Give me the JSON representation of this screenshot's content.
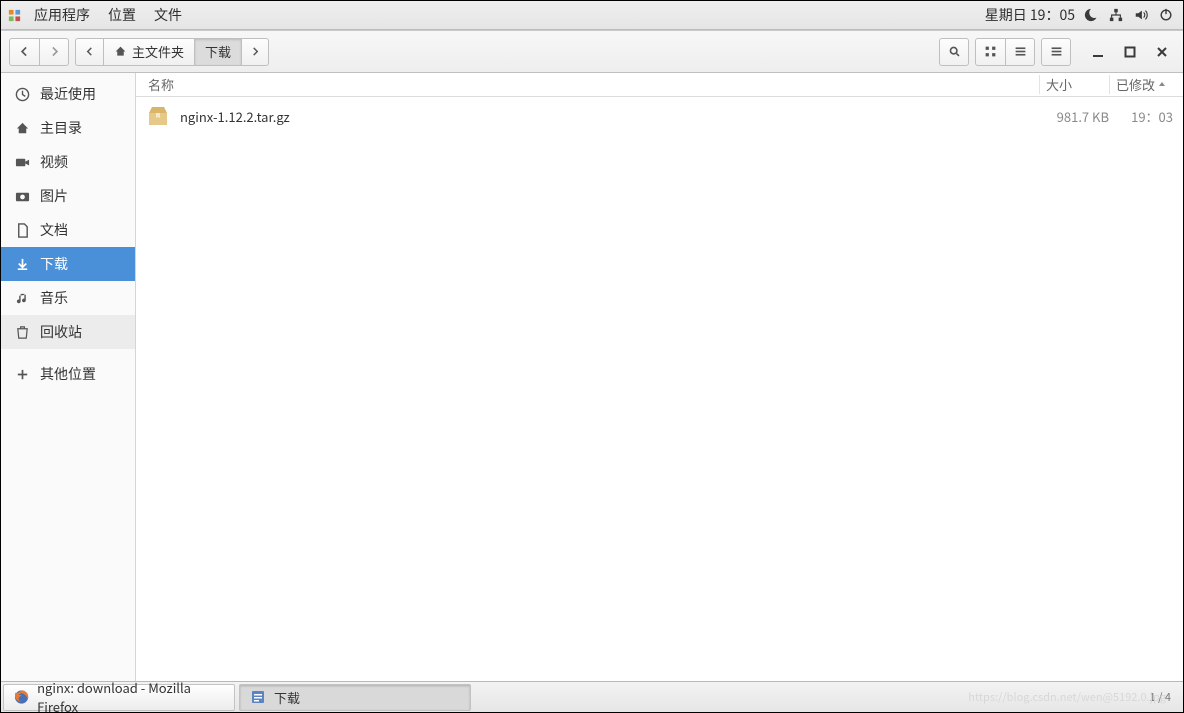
{
  "panel": {
    "apps": "应用程序",
    "places": "位置",
    "files": "文件",
    "datetime": "星期日 19：05"
  },
  "toolbar": {
    "path_home": "主文件夹",
    "path_current": "下载"
  },
  "sidebar": {
    "items": [
      {
        "label": "最近使用",
        "icon": "clock"
      },
      {
        "label": "主目录",
        "icon": "home"
      },
      {
        "label": "视频",
        "icon": "video"
      },
      {
        "label": "图片",
        "icon": "camera"
      },
      {
        "label": "文档",
        "icon": "doc"
      },
      {
        "label": "下载",
        "icon": "download"
      },
      {
        "label": "音乐",
        "icon": "music"
      },
      {
        "label": "回收站",
        "icon": "trash"
      }
    ],
    "other": "其他位置"
  },
  "columns": {
    "name": "名称",
    "size": "大小",
    "modified": "已修改"
  },
  "files": [
    {
      "name": "nginx-1.12.2.tar.gz",
      "size": "981.7 KB",
      "modified": "19：03"
    }
  ],
  "taskbar": {
    "firefox": "nginx: download - Mozilla Firefox",
    "files": "下载",
    "pages": "1 / 4"
  },
  "watermark": "https://blog.csdn.net/wen@5192.0.jpg"
}
